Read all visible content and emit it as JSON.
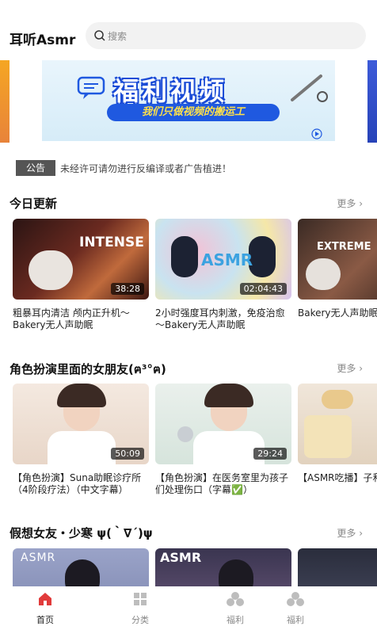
{
  "header": {
    "app_title": "耳听Asmr",
    "search_placeholder": "搜索"
  },
  "banner": {
    "title": "福利视频",
    "subtitle": "我们只做视频的搬运工"
  },
  "notice": {
    "tag": "公告",
    "text": "未经许可请勿进行反编译或者广告植进！"
  },
  "sections": [
    {
      "title": "今日更新",
      "more": "更多",
      "cards": [
        {
          "title": "粗暴耳内清洁 颅内正升机～Bakery无人声助眠",
          "duration": "38:28",
          "overlay": "INTENSE"
        },
        {
          "title": "2小时强度耳内刺激，免疫治愈～Bakery无人声助眠",
          "duration": "02:04:43",
          "overlay": "ASMR"
        },
        {
          "title": "Bakery无人声助眠探索",
          "duration": "",
          "overlay": "EXTREME"
        }
      ]
    },
    {
      "title": "角色扮演里面的女朋友(ฅ³°ฅ)",
      "more": "更多",
      "cards": [
        {
          "title": "【角色扮演】Suna助眠诊疗所（4阶段疗法）（中文字幕）",
          "duration": "50:09",
          "overlay": ""
        },
        {
          "title": "【角色扮演】在医务室里为孩子们处理伤口（字幕✅）",
          "duration": "29:24",
          "overlay": ""
        },
        {
          "title": "【ASMR吃播】子和团子糖葫芦",
          "duration": "",
          "overlay": ""
        }
      ]
    },
    {
      "title": "假想女友・少寒 ψ(｀∇´)ψ",
      "more": "更多",
      "cards": [
        {
          "title": "",
          "duration": "",
          "overlay": "ASMR"
        },
        {
          "title": "",
          "duration": "",
          "overlay": "ASMR"
        },
        {
          "title": "",
          "duration": "",
          "overlay": ""
        }
      ]
    }
  ],
  "tabbar": [
    {
      "label": "首页",
      "active": true
    },
    {
      "label": "分类",
      "active": false
    },
    {
      "label": "福利",
      "active": false
    },
    {
      "label": "福利",
      "active": false
    }
  ],
  "colors": {
    "accent": "#1f59e0",
    "active_tab": "#e13b3b",
    "inactive_tab": "#9a9a9a"
  }
}
